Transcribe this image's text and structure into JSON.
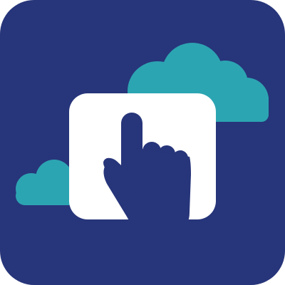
{
  "app_icon": {
    "icon_name": "touch-cloud-app-icon",
    "elements": [
      "rounded-square-background",
      "cloud-large",
      "cloud-small",
      "white-screen-tile",
      "pointing-hand"
    ],
    "colors": {
      "background": "#27357a",
      "cloud": "#2ca5b2",
      "tile": "#ffffff",
      "hand": "#27357a"
    }
  }
}
